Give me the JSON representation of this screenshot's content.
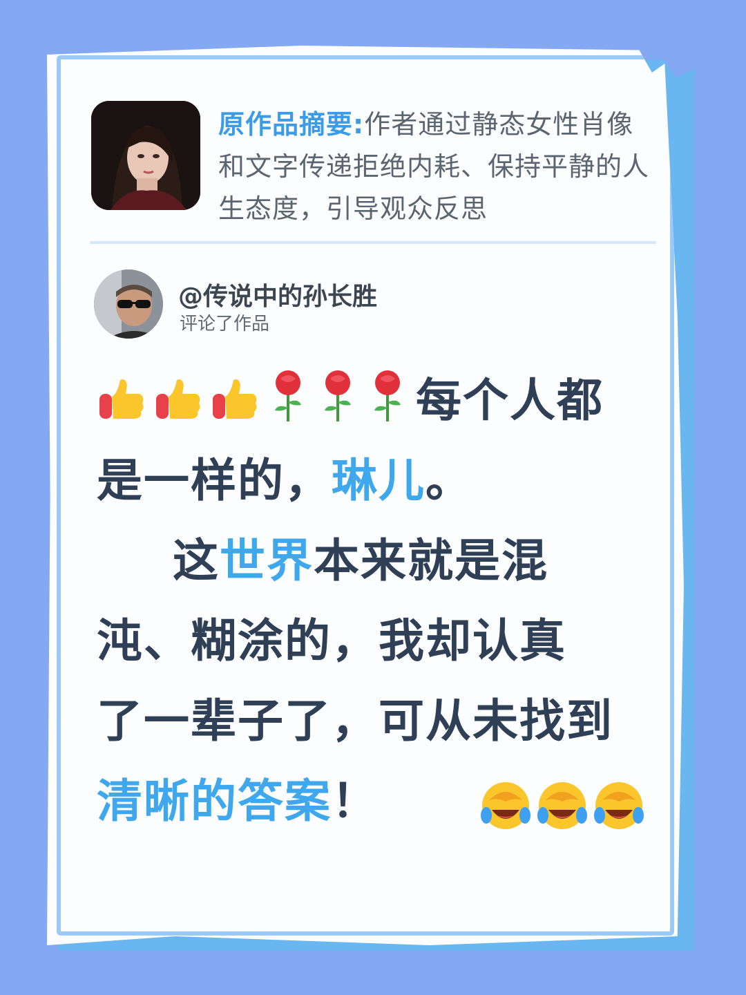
{
  "summary": {
    "label": "原作品摘要:",
    "text": "作者通过静态女性肖像和文字传递拒绝内耗、保持平静的人生态度，引导观众反思"
  },
  "commenter": {
    "username": "@传说中的孙长胜",
    "action": "评论了作品"
  },
  "comment": {
    "line1_text": "每个人都",
    "line2_text": "是一样的，",
    "line2_highlight": "琳儿",
    "line2_end": "。",
    "line3_start": "这",
    "line3_highlight": "世界",
    "line3_end": "本来就是混",
    "line4_text": "沌、糊涂的，我却认真",
    "line5_text": "了一辈子了，可从未找到",
    "line6_highlight": "清晰的答案",
    "line6_end": "！"
  },
  "emoji_names": [
    "thumbs-up",
    "rose",
    "laughing-crying-face"
  ],
  "colors": {
    "background": "#85a8f2",
    "paper": "#fbfdff",
    "highlight": "#3fa7ec",
    "main_text": "#2f3f55"
  }
}
